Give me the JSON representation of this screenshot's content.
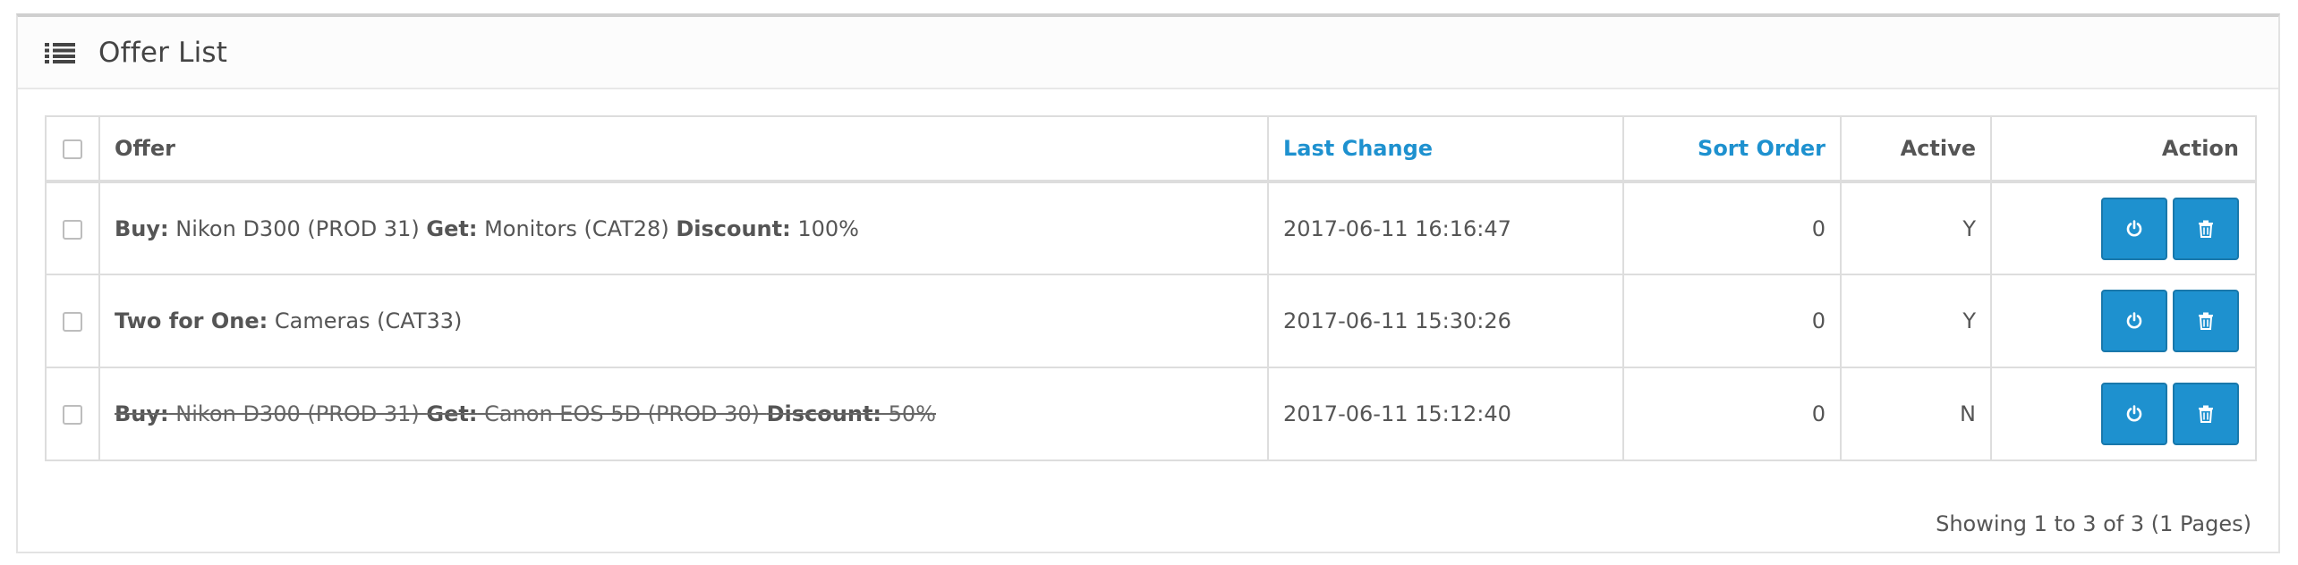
{
  "panel": {
    "title": "Offer List",
    "icon": "list-icon"
  },
  "table": {
    "headers": {
      "offer": "Offer",
      "last_change": "Last Change",
      "sort_order": "Sort Order",
      "active": "Active",
      "action": "Action"
    },
    "rows": [
      {
        "parts": [
          {
            "label": "Buy:",
            "text": " Nikon D300 (PROD 31) "
          },
          {
            "label": "Get:",
            "text": " Monitors (CAT28) "
          },
          {
            "label": "Discount:",
            "text": " 100%"
          }
        ],
        "last_change": "2017-06-11 16:16:47",
        "sort_order": "0",
        "active": "Y",
        "disabled": false
      },
      {
        "parts": [
          {
            "label": "Two for One:",
            "text": " Cameras (CAT33)"
          }
        ],
        "last_change": "2017-06-11 15:30:26",
        "sort_order": "0",
        "active": "Y",
        "disabled": false
      },
      {
        "parts": [
          {
            "label": "Buy:",
            "text": " Nikon D300 (PROD 31) "
          },
          {
            "label": "Get:",
            "text": " Canon EOS 5D (PROD 30) "
          },
          {
            "label": "Discount:",
            "text": " 50%"
          }
        ],
        "last_change": "2017-06-11 15:12:40",
        "sort_order": "0",
        "active": "N",
        "disabled": true
      }
    ]
  },
  "pagination": {
    "summary": "Showing 1 to 3 of 3 (1 Pages)"
  },
  "colors": {
    "accent": "#1e91cf",
    "button_border": "#1978ab"
  },
  "icons": {
    "toggle": "power-icon",
    "delete": "trash-icon",
    "header": "list-icon"
  }
}
